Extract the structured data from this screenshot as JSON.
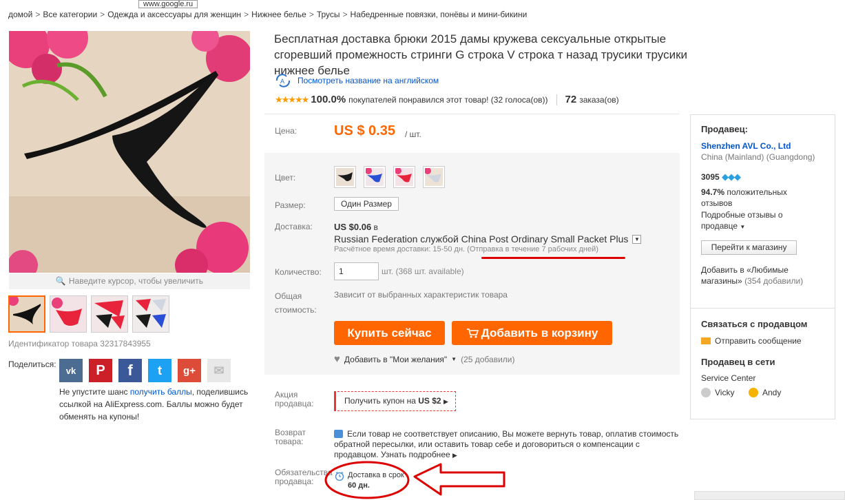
{
  "url_tooltip": "www.google.ru",
  "breadcrumb": [
    "домой",
    "Все категории",
    "Одежда и аксессуары для женщин",
    "Нижнее белье",
    "Трусы",
    "Набедренные повязки, понёвы и мини-бикини"
  ],
  "gallery": {
    "zoom_hint": "Наведите курсор, чтобы увеличить",
    "product_id": "Идентификатор товара 32317843955"
  },
  "share": {
    "label": "Поделиться:",
    "icons": [
      "vk-icon",
      "pinterest-icon",
      "facebook-icon",
      "twitter-icon",
      "google-plus-icon",
      "email-icon"
    ],
    "text_before": "Не упустите шанс ",
    "link": "получить баллы",
    "text_after": ", поделившись ссылкой на AliExpress.com. Баллы можно будет обменять на купоны!"
  },
  "product": {
    "title": "Бесплатная доставка брюки 2015 дамы кружева сексуальные открытые сгоревший промежность стринги G строка V строка т назад трусики трусики нижнее белье",
    "translate_link": "Посмотреть название на английском",
    "rating_pct": "100.0%",
    "rating_text": "покупателей понравился этот товар! (32 голоса(ов))",
    "orders_num": "72",
    "orders_text": "заказа(ов)"
  },
  "price": {
    "label": "Цена:",
    "value": "US $ 0.35",
    "unit": "/ шт."
  },
  "options": {
    "color_label": "Цвет:",
    "swatch_colors": [
      "#1a1a1a",
      "#2a4fd6",
      "#e8243c",
      "#cfd6e0"
    ],
    "size_label": "Размер:",
    "size_value": "Один Размер",
    "ship_label": "Доставка:",
    "ship_price": "US $0.06",
    "ship_price_suffix": "в",
    "ship_method": "Russian Federation службой China Post Ordinary Small Packet Plus",
    "ship_time": "Расчётное время доставки: 15-50 дн. (Отправка в течение 7 рабочих дней)",
    "qty_label": "Количество:",
    "qty_value": "1",
    "qty_avail": "шт. (368 шт. available)",
    "total_label": "Общая стоимость:",
    "total_value": "Зависит от выбранных характеристик товара",
    "buy_label": "Купить сейчас",
    "cart_label": "Добавить в корзину",
    "wish_label": "Добавить в \"Мои желания\"",
    "wish_count": "(25 добавили)"
  },
  "extras": {
    "promo_label": "Акция продавца:",
    "coupon_text": "Получить купон на",
    "coupon_value": "US $2",
    "return_label": "Возврат товара:",
    "return_text": "Если товар не соответствует описанию, Вы можете вернуть товар, оплатив стоимость обратной пересылки, или оставить товар себе и договориться о компенсации с продавцом.",
    "return_more": "Узнать подробнее",
    "oblig_label": "Обязательства продавца:",
    "delivery_text": "Доставка в срок",
    "delivery_days": "60 дн."
  },
  "seller": {
    "heading": "Продавец:",
    "store_name": "Shenzhen AVL Co., Ltd",
    "location": "China (Mainland) (Guangdong)",
    "score": "3095",
    "positive_pct": "94.7%",
    "positive_text": "положительных отзывов",
    "detailed_reviews": "Подробные отзывы о продавце",
    "go_store": "Перейти к магазину",
    "fav_text": "Добавить в «Любимые магазины»",
    "fav_count": "(354 добавили)",
    "contact_heading": "Связаться с продавцом",
    "send_message": "Отправить сообщение",
    "online_heading": "Продавец в сети",
    "service_center": "Service Center",
    "agents": [
      "Vicky",
      "Andy"
    ]
  },
  "colors": {
    "accent": "#ff6600",
    "link": "#0055cc",
    "annotation_red": "#dd0000"
  }
}
